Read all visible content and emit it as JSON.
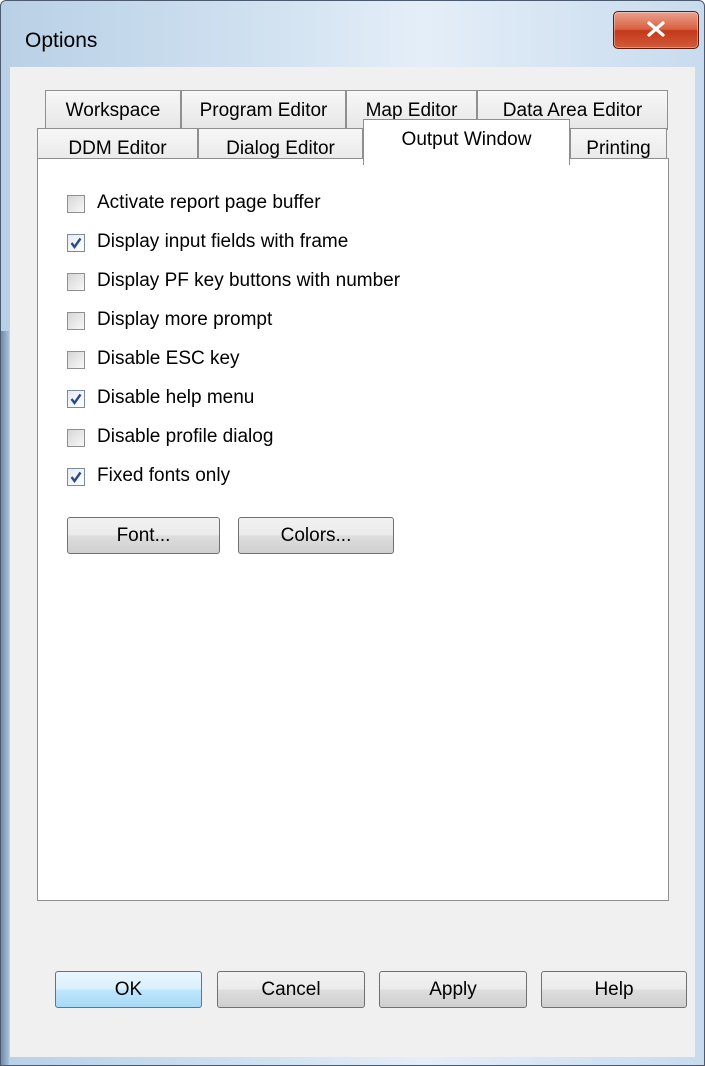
{
  "window": {
    "title": "Options"
  },
  "tabs": {
    "row1": [
      "Workspace",
      "Program Editor",
      "Map Editor",
      "Data Area Editor"
    ],
    "row2": [
      "DDM Editor",
      "Dialog Editor",
      "Output Window",
      "Printing"
    ],
    "active": "Output Window"
  },
  "options": [
    {
      "label": "Activate report page buffer",
      "checked": false
    },
    {
      "label": "Display input fields with frame",
      "checked": true
    },
    {
      "label": "Display PF key buttons with number",
      "checked": false
    },
    {
      "label": "Display more prompt",
      "checked": false
    },
    {
      "label": "Disable ESC key",
      "checked": false
    },
    {
      "label": "Disable help menu",
      "checked": true
    },
    {
      "label": "Disable profile dialog",
      "checked": false
    },
    {
      "label": "Fixed fonts only",
      "checked": true
    }
  ],
  "panel_buttons": {
    "font": "Font...",
    "colors": "Colors..."
  },
  "footer_buttons": {
    "ok": "OK",
    "cancel": "Cancel",
    "apply": "Apply",
    "help": "Help"
  },
  "colors": {
    "close_button": "#c9442a",
    "default_button_border": "#3c7fb1",
    "title_bar": "#cfe0f0"
  }
}
